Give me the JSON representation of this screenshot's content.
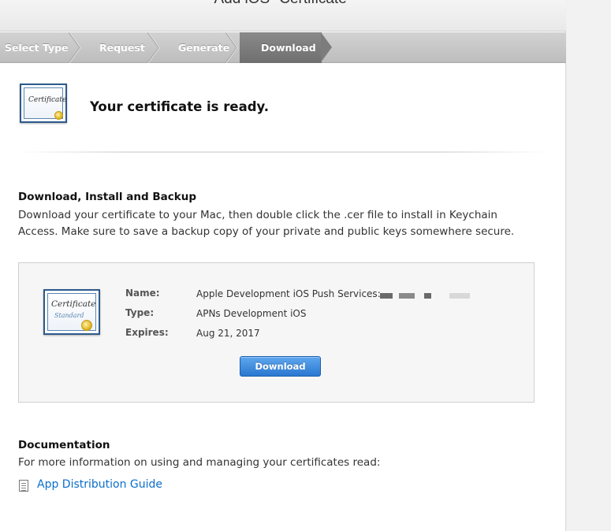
{
  "header": {
    "title": "Add iOS \"Certificate\""
  },
  "steps": [
    {
      "label": "Select Type"
    },
    {
      "label": "Request"
    },
    {
      "label": "Generate"
    },
    {
      "label": "Download"
    }
  ],
  "ready": {
    "icon_text": "Certificate",
    "message": "Your certificate is ready."
  },
  "install": {
    "title": "Download, Install and Backup",
    "body": "Download your certificate to your Mac, then double click the .cer file to install in Keychain Access. Make sure to save a backup copy of your private and public keys somewhere secure."
  },
  "certificate": {
    "icon_text": "Certificate",
    "icon_subtext": "Standard",
    "name_label": "Name:",
    "name_value": "Apple Development iOS Push Services:",
    "type_label": "Type:",
    "type_value": "APNs Development iOS",
    "expires_label": "Expires:",
    "expires_value": "Aug 21, 2017",
    "download_label": "Download"
  },
  "documentation": {
    "title": "Documentation",
    "body": "For more information on using and managing your certificates read:",
    "link_label": "App Distribution Guide"
  },
  "colors": {
    "link": "#0a6fcb",
    "button": "#2a77cf",
    "active_step": "#7c7c7c"
  }
}
